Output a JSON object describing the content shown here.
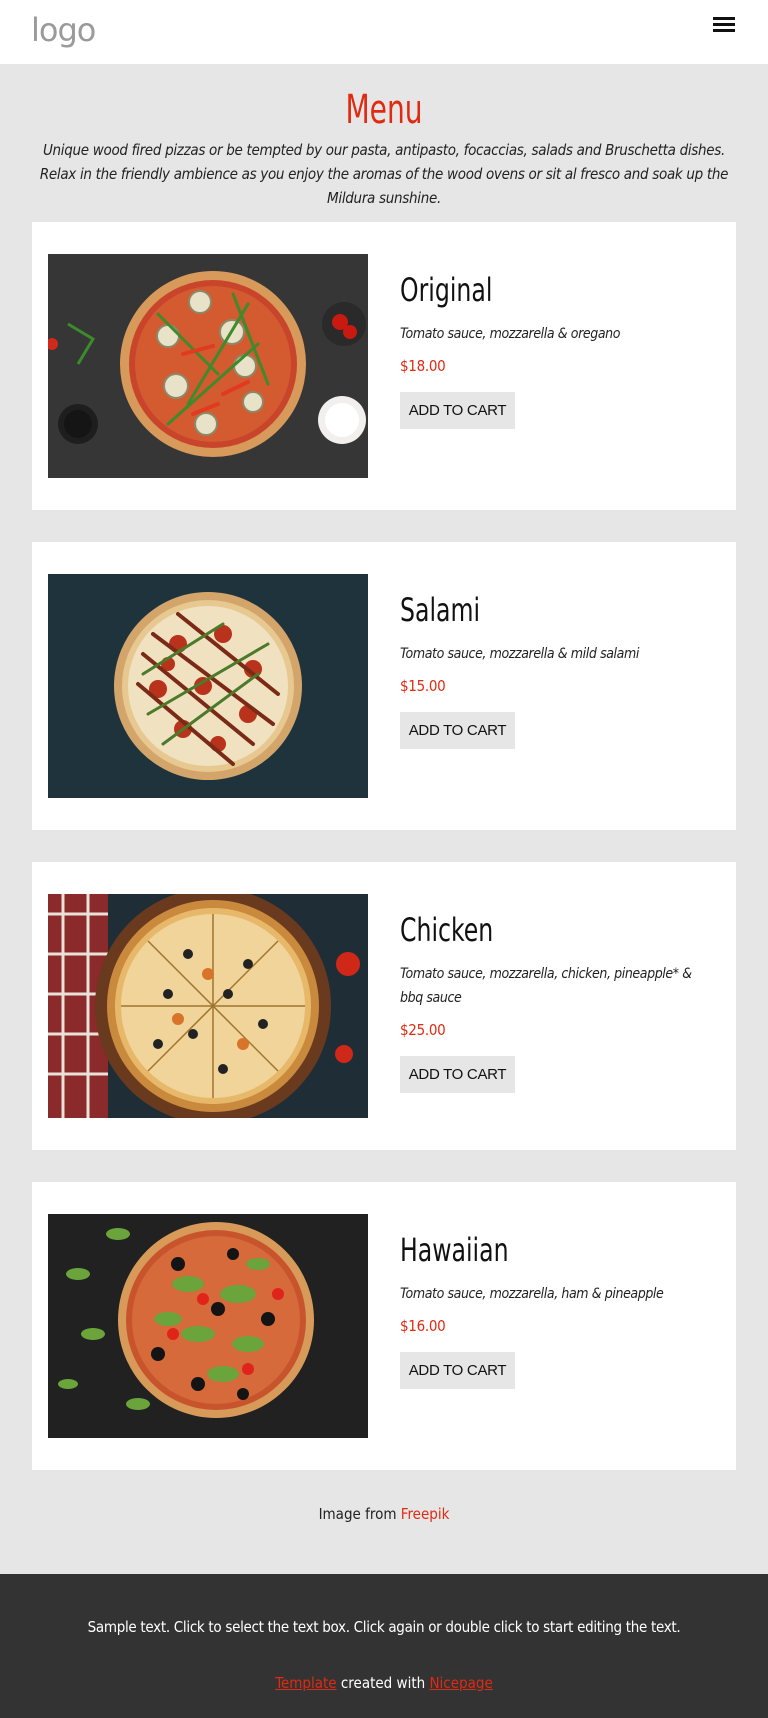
{
  "header": {
    "logo_text": "logo"
  },
  "menu": {
    "title": "Menu",
    "intro": "Unique wood fired pizzas or be tempted by our pasta, antipasto, focaccias, salads and Bruschetta dishes. Relax in the friendly ambience as you enjoy the aromas of the wood ovens or sit al fresco and soak up the Mildura sunshine."
  },
  "items": [
    {
      "name": "Original",
      "description": "Tomato sauce, mozzarella & oregano",
      "price": "$18.00",
      "button": "ADD TO CART"
    },
    {
      "name": "Salami",
      "description": "Tomato sauce, mozzarella & mild salami",
      "price": "$15.00",
      "button": "ADD TO CART"
    },
    {
      "name": "Chicken",
      "description": "Tomato sauce, mozzarella, chicken, pineapple* & bbq sauce",
      "price": "$25.00",
      "button": "ADD TO CART"
    },
    {
      "name": "Hawaiian",
      "description": "Tomato sauce, mozzarella, ham & pineapple",
      "price": "$16.00",
      "button": "ADD TO CART"
    }
  ],
  "credit": {
    "prefix": "Image from",
    "link": "Freepik"
  },
  "footer": {
    "sample_text": "Sample text. Click to select the text box. Click again or double click to start editing the text.",
    "template_link": "Template",
    "created_with": "created with",
    "nicepage_link": "Nicepage"
  },
  "colors": {
    "accent": "#e02a12",
    "background": "#e6e6e6",
    "card": "#ffffff",
    "footer": "#333333"
  }
}
